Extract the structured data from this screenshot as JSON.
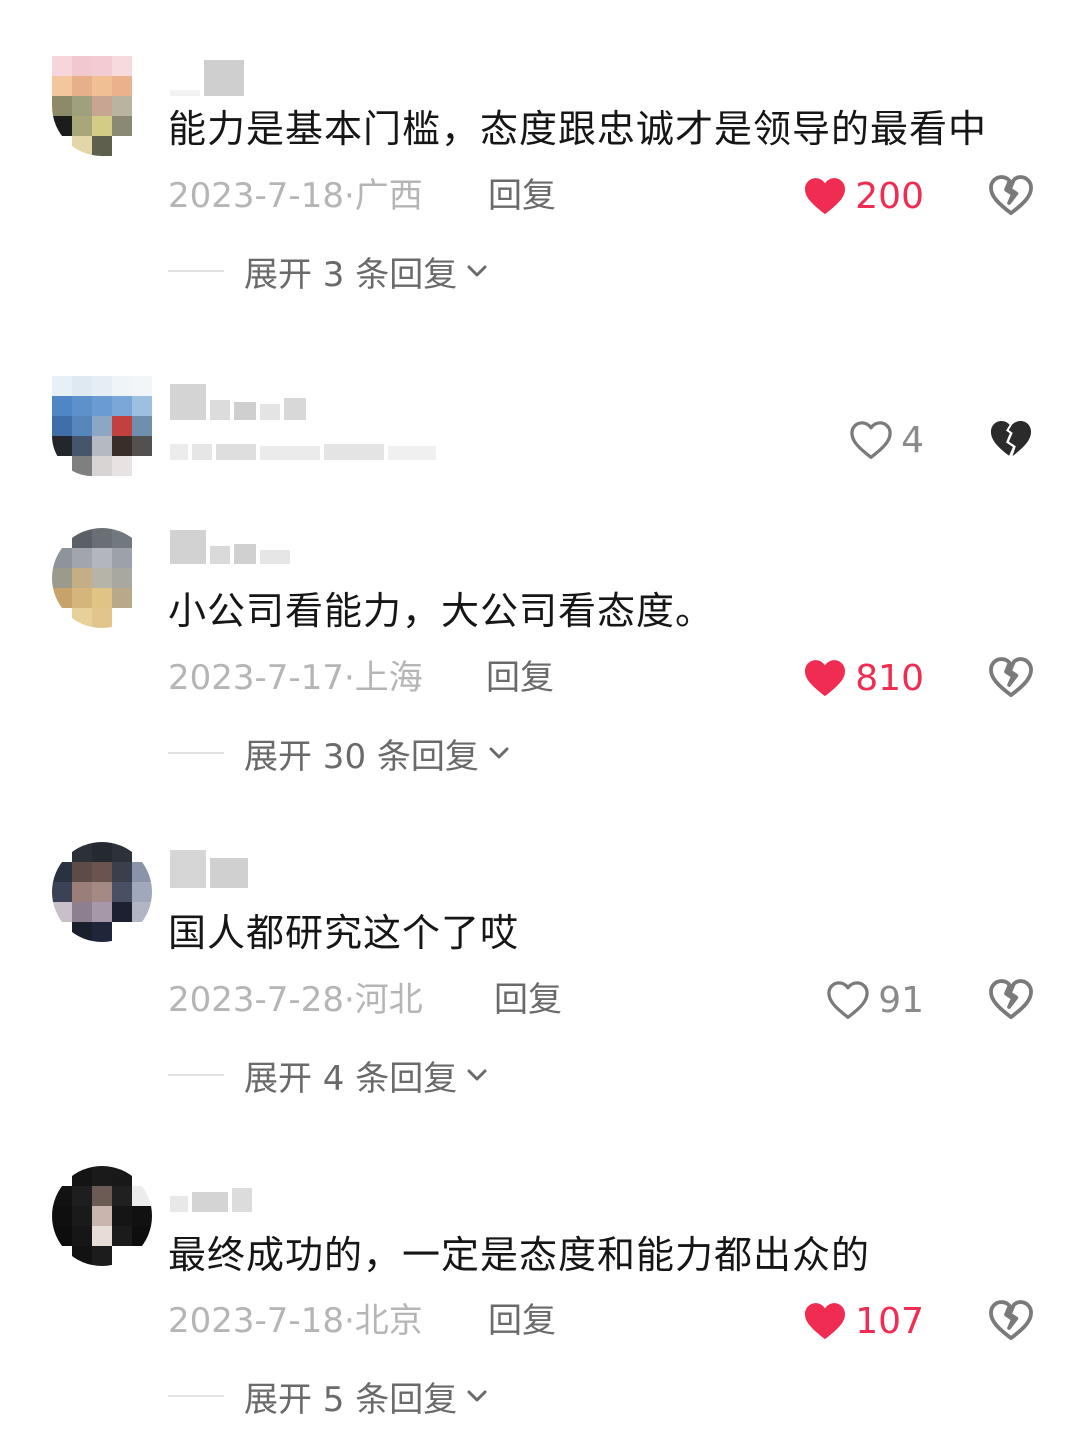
{
  "colors": {
    "like_active": "#f02c53",
    "like_inactive": "#8a8a8a",
    "meta_text": "#b5b5b5",
    "reply_text": "#6a6a6a"
  },
  "icons": {
    "like": "heart-icon",
    "dislike": "broken-heart-icon",
    "expand": "chevron-down-icon"
  },
  "comments": [
    {
      "text": "能力是基本门槛，态度跟忠诚才是领导的最看中",
      "date": "2023-7-18",
      "location": "广西",
      "reply_label": "回复",
      "likes": "200",
      "liked": true,
      "expand_label": "展开 3 条回复"
    },
    {
      "text": "",
      "likes": "4",
      "liked": false
    },
    {
      "text": "小公司看能力，大公司看态度。",
      "date": "2023-7-17",
      "location": "上海",
      "reply_label": "回复",
      "likes": "810",
      "liked": true,
      "expand_label": "展开 30 条回复"
    },
    {
      "text": "国人都研究这个了哎",
      "date": "2023-7-28",
      "location": "河北",
      "reply_label": "回复",
      "likes": "91",
      "liked": false,
      "expand_label": "展开 4 条回复"
    },
    {
      "text": "最终成功的，一定是态度和能力都出众的",
      "date": "2023-7-18",
      "location": "北京",
      "reply_label": "回复",
      "likes": "107",
      "liked": true,
      "expand_label": "展开 5 条回复"
    }
  ]
}
